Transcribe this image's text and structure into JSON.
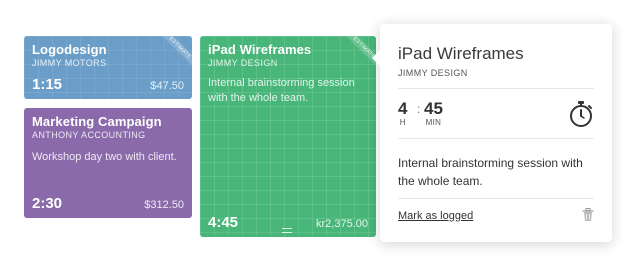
{
  "cards": [
    {
      "title": "Logodesign",
      "client": "JIMMY MOTORS",
      "duration": "1:15",
      "amount": "$47.50",
      "ribbon": "ESTIMATE",
      "color": "#6a9ec9"
    },
    {
      "title": "Marketing Campaign",
      "client": "ANTHONY ACCOUNTING",
      "description": "Workshop day two with client.",
      "duration": "2:30",
      "amount": "$312.50",
      "color": "#8b6aab"
    },
    {
      "title": "iPad Wireframes",
      "client": "JIMMY DESIGN",
      "description": "Internal brainstorming session with the whole team.",
      "duration": "4:45",
      "amount": "kr2,375.00",
      "ribbon": "ESTIMATE",
      "color": "#47b678"
    }
  ],
  "popover": {
    "title": "iPad Wireframes",
    "client": "JIMMY DESIGN",
    "hours": "4",
    "hours_unit": "H",
    "minutes": "45",
    "minutes_unit": "MIN",
    "colon": ":",
    "description": "Internal brainstorming session with the whole team.",
    "mark_logged": "Mark as logged",
    "icons": [
      "stopwatch-icon",
      "trash-icon"
    ]
  }
}
